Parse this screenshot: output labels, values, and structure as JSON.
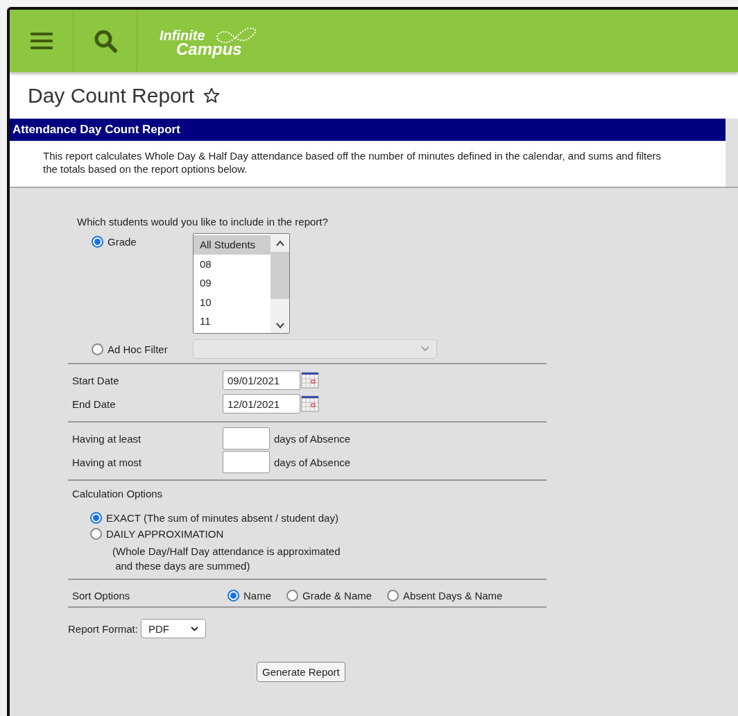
{
  "header": {
    "logo": [
      "Infinite",
      "Campus"
    ]
  },
  "page_title": "Day Count Report",
  "section": {
    "title": "Attendance Day Count Report",
    "description": "This report calculates Whole Day & Half Day attendance based off the number of minutes defined in the calendar, and sums and filters the totals based on the report options below."
  },
  "students": {
    "question": "Which students would you like to include in the report?",
    "choices": [
      {
        "label": "Grade",
        "selected": true
      },
      {
        "label": "Ad Hoc Filter",
        "selected": false
      }
    ],
    "grades": [
      {
        "label": "All Students",
        "selected": true
      },
      {
        "label": "08",
        "selected": false
      },
      {
        "label": "09",
        "selected": false
      },
      {
        "label": "10",
        "selected": false
      },
      {
        "label": "11",
        "selected": false
      }
    ]
  },
  "dates": [
    {
      "label": "Start Date",
      "value": "09/01/2021"
    },
    {
      "label": "End Date",
      "value": "12/01/2021"
    }
  ],
  "absence": [
    {
      "label": "Having at least",
      "suffix": "days of Absence"
    },
    {
      "label": "Having at most",
      "suffix": "days of Absence"
    }
  ],
  "calculation": {
    "label": "Calculation Options",
    "options": [
      {
        "label": "EXACT (The sum of minutes absent / student day)",
        "selected": true
      },
      {
        "label": "DAILY APPROXIMATION",
        "selected": false,
        "note": [
          "(Whole Day/Half Day attendance is approximated",
          "and these days are summed)"
        ]
      }
    ]
  },
  "sort": {
    "label": "Sort Options",
    "options": [
      {
        "label": "Name",
        "selected": true
      },
      {
        "label": "Grade & Name",
        "selected": false
      },
      {
        "label": "Absent Days & Name",
        "selected": false
      }
    ]
  },
  "report_format": {
    "label": "Report Format:",
    "value": "PDF"
  },
  "button": "Generate Report"
}
